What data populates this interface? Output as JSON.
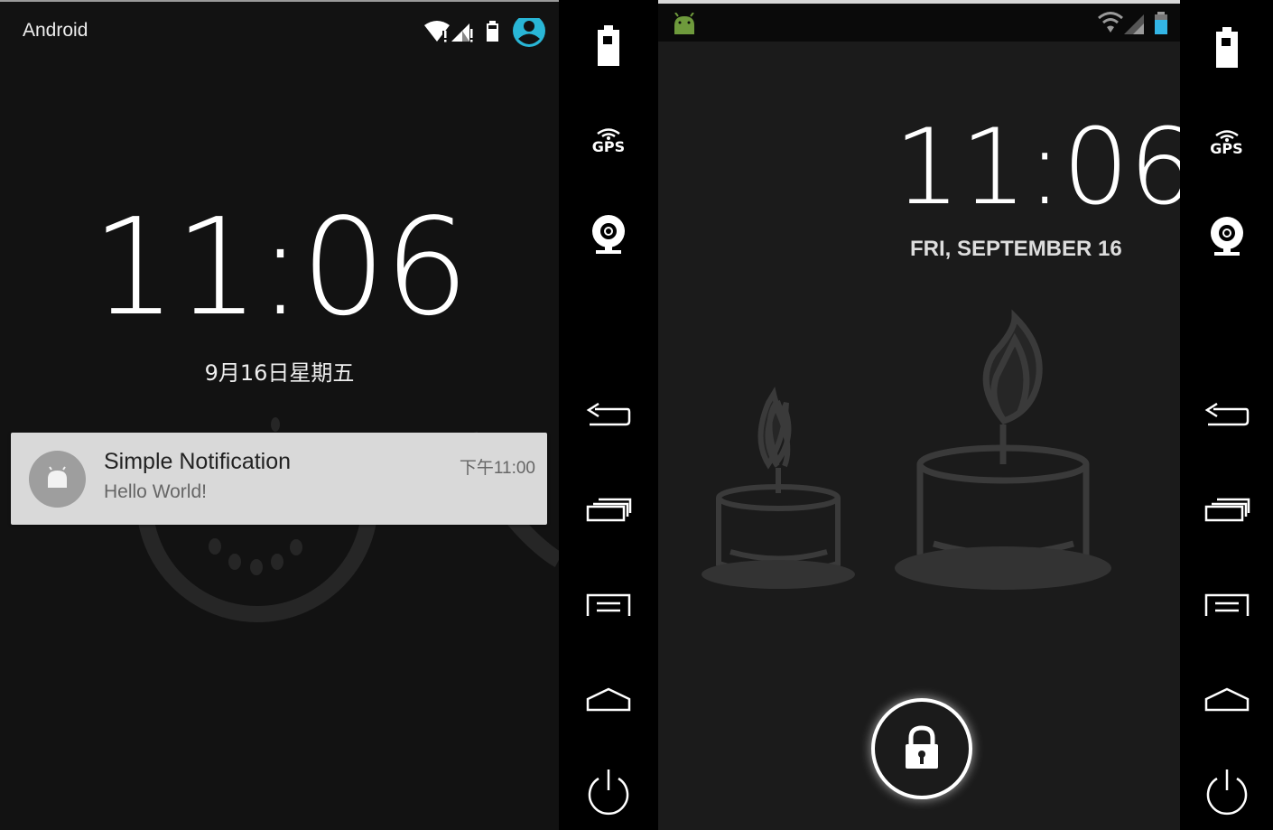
{
  "left_device": {
    "carrier": "Android",
    "clock": "11:06",
    "date": "9月16日星期五",
    "notification": {
      "title": "Simple Notification",
      "text": "Hello World!",
      "time": "下午11:00"
    },
    "status_icons": [
      "wifi-icon",
      "signal-icon",
      "battery-icon",
      "user-avatar-icon"
    ],
    "accent_color": "#29b6d6"
  },
  "right_device": {
    "clock": "11:06",
    "date": "FRI, SEPTEMBER 16",
    "status_icons": [
      "android-icon",
      "wifi-icon",
      "signal-icon",
      "battery-icon"
    ]
  },
  "sidebar": {
    "gps_label": "GPS",
    "items": [
      "battery",
      "gps",
      "camera",
      "back",
      "recent-apps",
      "menu",
      "home",
      "power"
    ]
  }
}
